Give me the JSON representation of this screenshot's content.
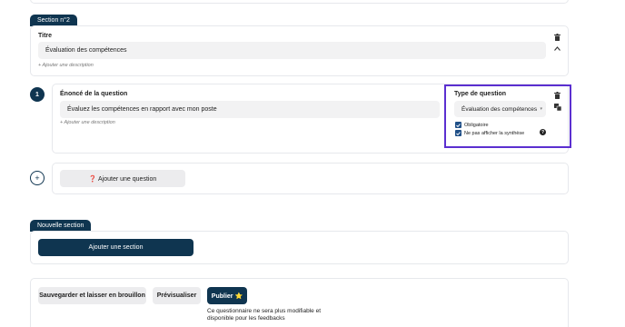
{
  "section2": {
    "tag": "Section n°2",
    "title_label": "Titre",
    "title_value": "Évaluation des compétences",
    "add_description": "+ Ajouter une description"
  },
  "question1": {
    "number": "1",
    "statement_label": "Énoncé de la question",
    "statement_value": "Évaluez les compétences en rapport avec mon poste",
    "add_description": "+ Ajouter une description",
    "type_label": "Type de question",
    "type_value": "Évaluation des compétences",
    "mandatory_label": "Obligatoire",
    "mandatory_checked": true,
    "hide_summary_label": "Ne pas afficher la synthèse",
    "hide_summary_checked": true,
    "help_glyph": "?"
  },
  "add_question": {
    "plus_glyph": "+",
    "label": "❓ Ajouter une question"
  },
  "new_section": {
    "tag": "Nouvelle section",
    "button_label": "Ajouter une section"
  },
  "footer": {
    "save_draft_label": "Sauvegarder et laisser en brouillon",
    "preview_label": "Prévisualiser",
    "publish_label": "Publier ⭐",
    "publish_note_line1": "Ce questionnaire ne sera plus modifiable et",
    "publish_note_line2": "disponible pour les feedbacks"
  },
  "colors": {
    "navy": "#0f3550",
    "highlight": "#5b2fd0",
    "checkbox": "#1f4f87"
  }
}
